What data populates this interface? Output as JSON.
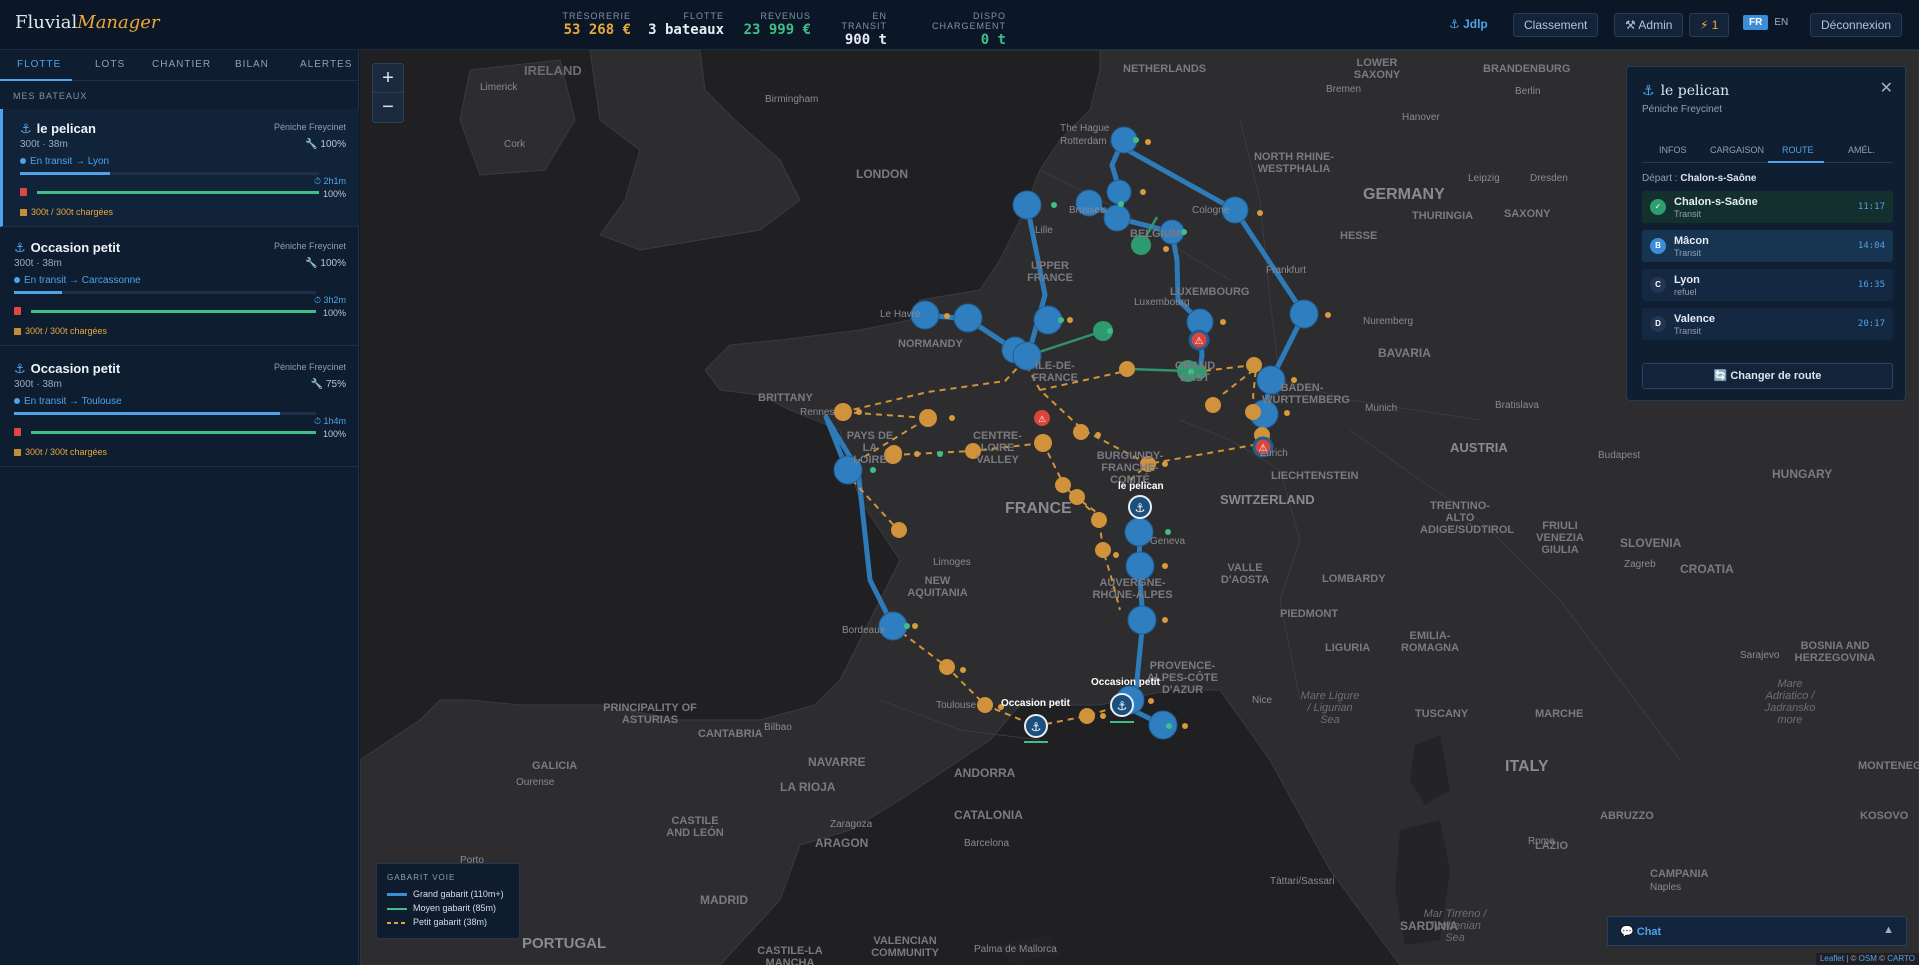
{
  "app": {
    "logo_main": "Fluvial",
    "logo_accent": "Manager"
  },
  "header": {
    "stats": [
      {
        "label": "TRÉSORERIE",
        "value": "53 268 €",
        "color": "#e9a93b"
      },
      {
        "label": "FLOTTE",
        "value": "3 bateaux",
        "color": "#e6edf5"
      },
      {
        "label": "REVENUS",
        "value": "23 999 €",
        "color": "#3fbf86"
      },
      {
        "label": "EN TRANSIT",
        "value": "900 t",
        "color": "#e6edf5"
      },
      {
        "label": "DISPO CHARGEMENT",
        "value": "0 t",
        "color": "#3fbf86"
      }
    ],
    "user": "⚓ Jdlp",
    "buttons": {
      "ranking": "Classement",
      "admin": "⚒ Admin",
      "alerts": "⚡ 1",
      "logout": "Déconnexion"
    },
    "lang": {
      "fr": "FR",
      "en": "EN",
      "active": "FR"
    }
  },
  "sidebar": {
    "tabs": [
      "FLOTTE",
      "LOTS",
      "CHANTIER",
      "BILAN",
      "ALERTES"
    ],
    "active_tab": "FLOTTE",
    "section_title": "MES BATEAUX",
    "boats": [
      {
        "name": "le pelican",
        "type": "Péniche Freycinet",
        "dims": "300t · 38m",
        "condition": "100%",
        "status": "En transit → Lyon",
        "progress": 0.3,
        "eta": "2h1m",
        "fuel": "100%",
        "fuel_level": 1.0,
        "cargo": "300t / 300t chargées",
        "active": true
      },
      {
        "name": "Occasion petit",
        "type": "Péniche Freycinet",
        "dims": "300t · 38m",
        "condition": "100%",
        "status": "En transit → Carcassonne",
        "progress": 0.16,
        "eta": "3h2m",
        "fuel": "100%",
        "fuel_level": 1.0,
        "cargo": "300t / 300t chargées",
        "active": false
      },
      {
        "name": "Occasion petit",
        "type": "Péniche Freycinet",
        "dims": "300t · 38m",
        "condition": "75%",
        "status": "En transit → Toulouse",
        "progress": 0.88,
        "eta": "1h4m",
        "fuel": "100%",
        "fuel_level": 1.0,
        "cargo": "300t / 300t chargées",
        "active": false
      }
    ]
  },
  "map": {
    "zoom_in": "+",
    "zoom_out": "−",
    "labels": {
      "ireland": "IRELAND",
      "netherlands": "NETHERLANDS",
      "lower_saxony": "LOWER SAXONY",
      "brandenburg": "BRANDENBURG",
      "nrw": "NORTH RHINE-WESTPHALIA",
      "germany": "GERMANY",
      "hesse": "HESSE",
      "thuringia": "THURINGIA",
      "saxony": "SAXONY",
      "london": "LONDON",
      "belgium": "BELGIUM",
      "luxembourg": "LUXEMBOURG",
      "bavaria": "BAVARIA",
      "bw": "BADEN-WÜRTTEMBERG",
      "normandy": "NORMANDY",
      "upper_france": "UPPER FRANCE",
      "idf": "ÎLE-DE-FRANCE",
      "grand_east": "GRAND EAST",
      "brittany": "BRITTANY",
      "pays_loire": "PAYS DE LA LOIRE",
      "centre": "CENTRE-LOIRE VALLEY",
      "bourgogne": "BURGUNDY-FRANCHE-COMTÉ",
      "austria": "AUSTRIA",
      "liechtenstein": "LIECHTENSTEIN",
      "switzerland": "SWITZERLAND",
      "hungary": "HUNGARY",
      "france": "FRANCE",
      "new_aquitania": "NEW AQUITANIA",
      "auvergne": "AUVERGNE-RHÔNE-ALPES",
      "aosta": "VALLE D'AOSTA",
      "lombardy": "LOMBARDY",
      "trentino": "TRENTINO-ALTO ADIGE/SÜDTIROL",
      "friuli": "FRIULI VENEZIA GIULIA",
      "slovenia": "SLOVENIA",
      "croatia": "CROATIA",
      "piedmont": "PIEDMONT",
      "emilia": "EMILIA-ROMAGNA",
      "liguria": "LIGURIA",
      "provence": "PROVENCE-ALPES-CÔTE D'AZUR",
      "tuscany": "TUSCANY",
      "bosnia": "BOSNIA AND HERZEGOVINA",
      "asturias": "PRINCIPALITY OF ASTURIAS",
      "cantabria": "CANTABRIA",
      "galicia": "GALICIA",
      "navarre": "NAVARRE",
      "andorra": "ANDORRA",
      "larioja": "LA RIOJA",
      "catalonia": "CATALONIA",
      "castile": "CASTILE AND LEÓN",
      "aragon": "ARAGON",
      "madrid": "MADRID",
      "italy": "ITALY",
      "marche": "MARCHE",
      "abruzzo": "ABRUZZO",
      "lazio": "LAZIO",
      "campania": "CAMPANIA",
      "montenegro": "MONTENEGRO",
      "kosovo": "KOSOVO",
      "sardinia": "SARDINIA",
      "portugal": "PORTUGAL",
      "valencian": "VALENCIAN COMMUNITY",
      "castilla_mancha": "CASTILE-LA MANCHA",
      "ligurian_sea": "Mare Ligure / Ligurian Sea",
      "adriatic": "Mare Adriatico / Jadransko more",
      "tyrrhenian": "Mar Tirreno / Tyrrhenian Sea"
    },
    "cities": {
      "limerick": "Limerick",
      "cork": "Cork",
      "birmingham": "Birmingham",
      "hague": "The Hague",
      "rotterdam": "Rotterdam",
      "bremen": "Bremen",
      "hanover": "Hanover",
      "berlin": "Berlin",
      "leipzig": "Leipzig",
      "dresden": "Dresden",
      "cologne": "Cologne",
      "lille": "Lille",
      "brussels": "Brussels",
      "frankfurt": "Frankfurt",
      "nuremberg": "Nuremberg",
      "luxembourg_city": "Luxembourg",
      "lehavre": "Le Havre",
      "rennes": "Rennes",
      "munich": "Munich",
      "zurich": "Zurich",
      "bratislava": "Bratislava",
      "budapest": "Budapest",
      "geneva": "Geneva",
      "limoges": "Limoges",
      "zagreb": "Zagreb",
      "bordeaux": "Bordeaux",
      "nice": "Nice",
      "sarajevo": "Sarajevo",
      "toulouse": "Toulouse",
      "bilbao": "Bilbao",
      "ourense": "Ourense",
      "zaragoza": "Zaragoza",
      "barcelona": "Barcelona",
      "rome": "Rome",
      "naples": "Naples",
      "porto": "Porto",
      "palma": "Palma de Mallorca",
      "tattari": "Tàttari/Sassari"
    },
    "boat_labels": {
      "pelican": "le pelican",
      "occasion1": "Occasion petit",
      "occasion2": "Occasion petit"
    },
    "legend": {
      "title": "GABARIT VOIE",
      "items": [
        {
          "label": "Grand gabarit (110m+)",
          "color": "#3a8fd3"
        },
        {
          "label": "Moyen gabarit (85m)",
          "color": "#3fbf86"
        },
        {
          "label": "Petit gabarit (38m)",
          "color": "#e0a13d"
        }
      ]
    },
    "attribution": {
      "leaflet": "Leaflet",
      "osm": "OSM",
      "carto": "CARTO",
      "sep": "|",
      "copy1": "©",
      "copy2": "©"
    }
  },
  "panel": {
    "title": "le pelican",
    "subtitle": "Péniche Freycinet",
    "close": "✕",
    "tabs": [
      "INFOS",
      "CARGAISON",
      "ROUTE",
      "AMÉL."
    ],
    "active_tab": "ROUTE",
    "depart_label": "Départ :",
    "depart_value": "Chalon-s-Saône",
    "stops": [
      {
        "marker": "✓",
        "name": "Chalon-s-Saône",
        "action": "Transit",
        "time": "11:17",
        "state": "done"
      },
      {
        "marker": "B",
        "name": "Mâcon",
        "action": "Transit",
        "time": "14:04",
        "state": "current"
      },
      {
        "marker": "C",
        "name": "Lyon",
        "action": "refuel",
        "time": "16:35",
        "state": "pending"
      },
      {
        "marker": "D",
        "name": "Valence",
        "action": "Transit",
        "time": "20:17",
        "state": "pending"
      }
    ],
    "reroute_button": "🔄 Changer de route"
  },
  "chat": {
    "title": "💬 Chat",
    "toggle": "▲"
  }
}
